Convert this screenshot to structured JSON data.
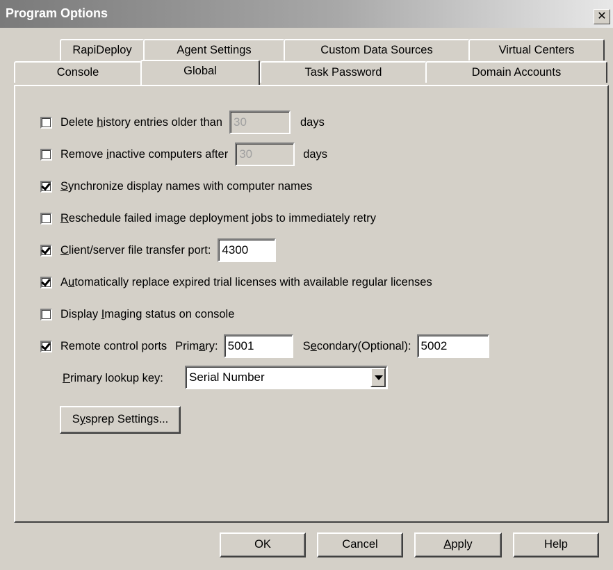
{
  "window": {
    "title": "Program Options",
    "close_glyph": "✕"
  },
  "tabs_row1": [
    "RapiDeploy",
    "Agent Settings",
    "Custom Data Sources",
    "Virtual Centers"
  ],
  "tabs_row2": [
    "Console",
    "Global",
    "Task Password",
    "Domain Accounts"
  ],
  "active_tab": "Global",
  "options": {
    "delete_history": {
      "checked": false,
      "label_pre": "Delete ",
      "label_ul": "h",
      "label_post": "istory entries older than",
      "value": "30",
      "suffix": "days",
      "disabled": true
    },
    "remove_inactive": {
      "checked": false,
      "label_pre": "Remove ",
      "label_ul": "i",
      "label_post": "nactive computers after",
      "value": "30",
      "suffix": "days",
      "disabled": true
    },
    "sync_names": {
      "checked": true,
      "label_pre": "",
      "label_ul": "S",
      "label_post": "ynchronize display names with computer names"
    },
    "reschedule": {
      "checked": false,
      "label_pre": "",
      "label_ul": "R",
      "label_post": "eschedule failed image deployment jobs to immediately retry"
    },
    "transfer_port": {
      "checked": true,
      "label_pre": "",
      "label_ul": "C",
      "label_post": "lient/server file transfer port:",
      "value": "4300"
    },
    "auto_replace": {
      "checked": true,
      "label_pre": "A",
      "label_ul": "u",
      "label_post": "tomatically replace expired trial licenses with available regular licenses"
    },
    "imaging_status": {
      "checked": false,
      "label_pre": "Display ",
      "label_ul": "I",
      "label_post": "maging status on console"
    },
    "remote_control": {
      "checked": true,
      "label": "Remote control ports",
      "primary_label_pre": "Prim",
      "primary_label_ul": "a",
      "primary_label_post": "ry:",
      "primary_value": "5001",
      "secondary_label_pre": "S",
      "secondary_label_ul": "e",
      "secondary_label_post": "condary(Optional):",
      "secondary_value": "5002"
    }
  },
  "lookup": {
    "label_ul": "P",
    "label_post": "rimary lookup key:",
    "value": "Serial Number"
  },
  "sysprep_button": {
    "pre": "S",
    "ul": "y",
    "post": "sprep Settings..."
  },
  "footer": {
    "ok": "OK",
    "cancel": "Cancel",
    "apply_ul": "A",
    "apply_post": "pply",
    "help": "Help"
  }
}
